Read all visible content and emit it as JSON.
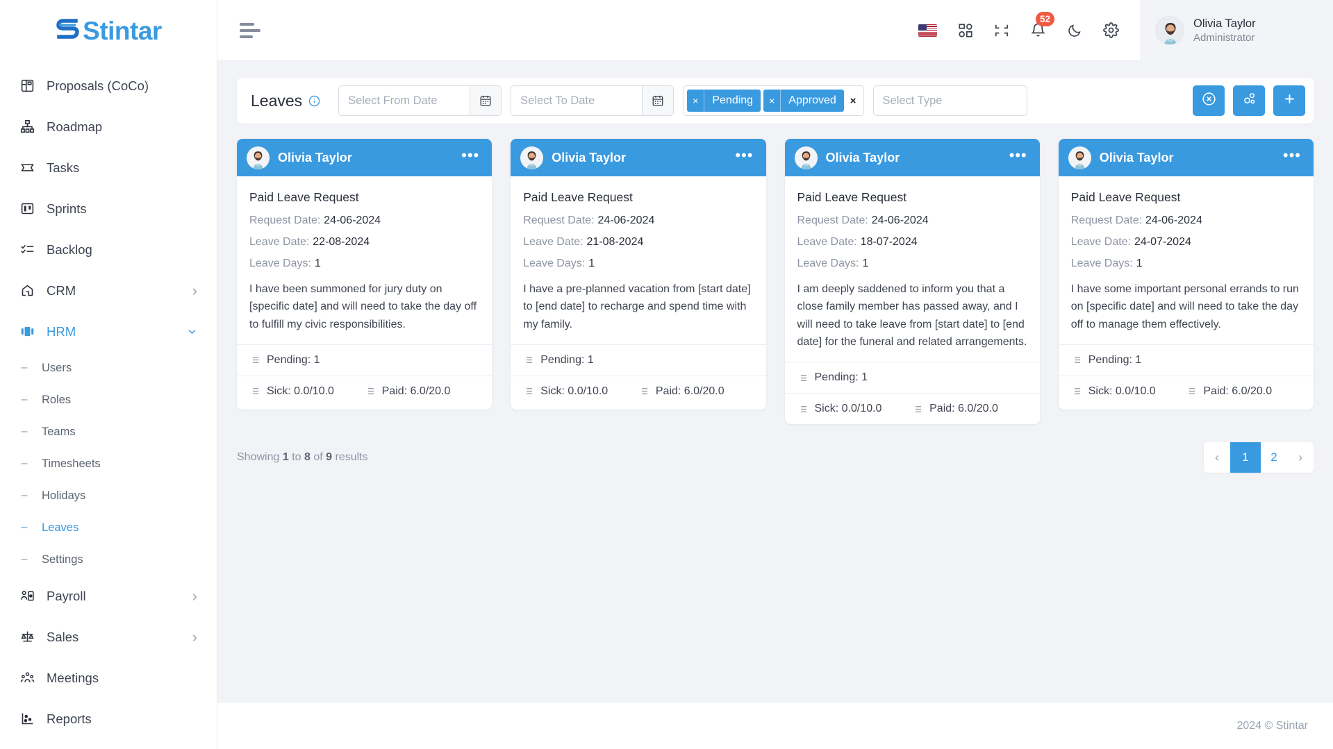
{
  "brand": {
    "name": "Stintar",
    "accent": "#3a9ae0"
  },
  "sidebar": {
    "items": [
      {
        "label": "Proposals (CoCo)",
        "icon": "proposals-icon",
        "chevron": ""
      },
      {
        "label": "Roadmap",
        "icon": "roadmap-icon",
        "chevron": ""
      },
      {
        "label": "Tasks",
        "icon": "tasks-icon",
        "chevron": ""
      },
      {
        "label": "Sprints",
        "icon": "sprints-icon",
        "chevron": ""
      },
      {
        "label": "Backlog",
        "icon": "backlog-icon",
        "chevron": ""
      },
      {
        "label": "CRM",
        "icon": "crm-icon",
        "chevron": "›"
      },
      {
        "label": "HRM",
        "icon": "hrm-icon",
        "chevron": "⌄"
      },
      {
        "label": "Payroll",
        "icon": "payroll-icon",
        "chevron": "›"
      },
      {
        "label": "Sales",
        "icon": "sales-icon",
        "chevron": "›"
      },
      {
        "label": "Meetings",
        "icon": "meetings-icon",
        "chevron": ""
      },
      {
        "label": "Reports",
        "icon": "reports-icon",
        "chevron": ""
      }
    ],
    "hrm_sub": [
      {
        "label": "Users"
      },
      {
        "label": "Roles"
      },
      {
        "label": "Teams"
      },
      {
        "label": "Timesheets"
      },
      {
        "label": "Holidays"
      },
      {
        "label": "Leaves"
      },
      {
        "label": "Settings"
      }
    ],
    "active_item": "HRM",
    "active_sub": "Leaves"
  },
  "topbar": {
    "menu_icon": "hamburger-icon",
    "language_flag": "us-flag-icon",
    "apps_icon": "apps-grid-icon",
    "fullscreen_icon": "compress-icon",
    "notifications_icon": "bell-icon",
    "notifications_count": "52",
    "dark_mode_icon": "moon-icon",
    "settings_icon": "gear-icon",
    "user": {
      "name": "Olivia Taylor",
      "role": "Administrator"
    }
  },
  "filters": {
    "title": "Leaves",
    "info_icon": "info-icon",
    "from_date_placeholder": "Select From Date",
    "to_date_placeholder": "Select To Date",
    "from_date_value": "",
    "to_date_value": "",
    "calendar_icon": "calendar-icon",
    "status_tags": [
      {
        "label": "Pending",
        "remove": "×"
      },
      {
        "label": "Approved",
        "remove": "×"
      }
    ],
    "tags_clear_all": "×",
    "type_placeholder": "Select Type",
    "type_value": "",
    "buttons": [
      {
        "name": "reset-filters-button",
        "icon": "circle-x-icon"
      },
      {
        "name": "assign-leave-button",
        "icon": "users-settings-icon"
      },
      {
        "name": "add-leave-button",
        "icon": "plus-icon"
      }
    ]
  },
  "cards": [
    {
      "user": "Olivia Taylor",
      "menu": "•••",
      "title": "Paid Leave Request",
      "request_date_label": "Request Date:",
      "request_date": "24-06-2024",
      "leave_date_label": "Leave Date:",
      "leave_date": "22-08-2024",
      "leave_days_label": "Leave Days:",
      "leave_days": "1",
      "description": "I have been summoned for jury duty on [specific date] and will need to take the day off to fulfill my civic responsibilities.",
      "pending": "Pending: 1",
      "sick": "Sick: 0.0/10.0",
      "paid": "Paid: 6.0/20.0"
    },
    {
      "user": "Olivia Taylor",
      "menu": "•••",
      "title": "Paid Leave Request",
      "request_date_label": "Request Date:",
      "request_date": "24-06-2024",
      "leave_date_label": "Leave Date:",
      "leave_date": "21-08-2024",
      "leave_days_label": "Leave Days:",
      "leave_days": "1",
      "description": "I have a pre-planned vacation from [start date] to [end date] to recharge and spend time with my family.",
      "pending": "Pending: 1",
      "sick": "Sick: 0.0/10.0",
      "paid": "Paid: 6.0/20.0"
    },
    {
      "user": "Olivia Taylor",
      "menu": "•••",
      "title": "Paid Leave Request",
      "request_date_label": "Request Date:",
      "request_date": "24-06-2024",
      "leave_date_label": "Leave Date:",
      "leave_date": "18-07-2024",
      "leave_days_label": "Leave Days:",
      "leave_days": "1",
      "description": "I am deeply saddened to inform you that a close family member has passed away, and I will need to take leave from [start date] to [end date] for the funeral and related arrangements.",
      "pending": "Pending: 1",
      "sick": "Sick: 0.0/10.0",
      "paid": "Paid: 6.0/20.0"
    },
    {
      "user": "Olivia Taylor",
      "menu": "•••",
      "title": "Paid Leave Request",
      "request_date_label": "Request Date:",
      "request_date": "24-06-2024",
      "leave_date_label": "Leave Date:",
      "leave_date": "24-07-2024",
      "leave_days_label": "Leave Days:",
      "leave_days": "1",
      "description": "I have some important personal errands to run on [specific date] and will need to take the day off to manage them effectively.",
      "pending": "Pending: 1",
      "sick": "Sick: 0.0/10.0",
      "paid": "Paid: 6.0/20.0"
    }
  ],
  "pagination": {
    "showing_prefix": "Showing",
    "from": "1",
    "to_word": "to",
    "to": "8",
    "of_word": "of",
    "total": "9",
    "results_word": "results",
    "prev": "‹",
    "pages": [
      "1",
      "2"
    ],
    "current_page": "1",
    "next": "›"
  },
  "footer": {
    "copyright": "2024 © Stintar"
  }
}
